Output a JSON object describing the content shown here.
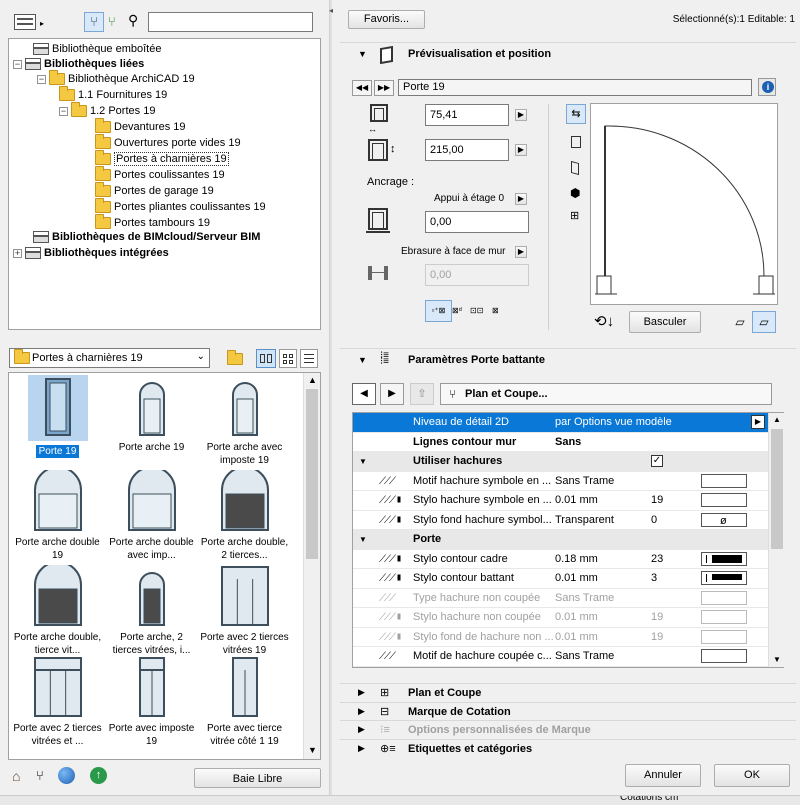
{
  "top_bar": {
    "favoris": "Favoris...",
    "selection_info": "Sélectionné(s):1 Editable: 1"
  },
  "tree": {
    "items": [
      {
        "label": "Bibliothèque emboîtée",
        "bold": false
      },
      {
        "label": "Bibliothèques liées",
        "bold": true
      },
      {
        "label": "Bibliothèque ArchiCAD 19",
        "bold": false
      },
      {
        "label": "1.1 Fournitures 19",
        "bold": false
      },
      {
        "label": "1.2 Portes 19",
        "bold": false
      },
      {
        "label": "Devantures 19",
        "bold": false
      },
      {
        "label": "Ouvertures porte vides 19",
        "bold": false
      },
      {
        "label": "Portes à charnières 19",
        "bold": false
      },
      {
        "label": "Portes coulissantes 19",
        "bold": false
      },
      {
        "label": "Portes de garage 19",
        "bold": false
      },
      {
        "label": "Portes pliantes coulissantes 19",
        "bold": false
      },
      {
        "label": "Portes tambours 19",
        "bold": false
      },
      {
        "label": "Bibliothèques de BIMcloud/Serveur BIM",
        "bold": true
      },
      {
        "label": "Bibliothèques intégrées",
        "bold": true
      }
    ]
  },
  "folder_dropdown": {
    "value": "Portes à charnières 19"
  },
  "thumbs": [
    {
      "label": "Porte 19"
    },
    {
      "label": "Porte arche 19"
    },
    {
      "label": "Porte arche avec imposte 19"
    },
    {
      "label": "Porte arche double 19"
    },
    {
      "label": "Porte arche double avec imp..."
    },
    {
      "label": "Porte arche double, 2 tierces..."
    },
    {
      "label": "Porte arche double, tierce vit..."
    },
    {
      "label": "Porte arche, 2 tierces vitrées, i..."
    },
    {
      "label": "Porte avec 2 tierces vitrées 19"
    },
    {
      "label": "Porte avec 2 tierces vitrées et ..."
    },
    {
      "label": "Porte avec imposte 19"
    },
    {
      "label": "Porte avec tierce vitrée côté 1 19"
    }
  ],
  "bottom_left": {
    "baie_libre": "Baie Libre"
  },
  "preview": {
    "header": "Prévisualisation et position",
    "object_name": "Porte 19",
    "width": "75,41",
    "height": "215,00",
    "ancrage_label": "Ancrage :",
    "anchor_option": "Appui à étage 0",
    "anchor_value": "0,00",
    "ebrasure_label": "Ebrasure à face de mur",
    "ebrasure_value": "0,00",
    "basculer": "Basculer"
  },
  "params": {
    "header": "Paramètres Porte battante",
    "sub_title": "Plan et Coupe...",
    "rows": [
      {
        "name": "Niveau de détail 2D",
        "value": "par Options vue modèle",
        "num": "",
        "state": "selected"
      },
      {
        "name": "Lignes contour mur",
        "value": "Sans",
        "num": "",
        "state": "bold"
      },
      {
        "name": "Utiliser hachures",
        "value": "",
        "num": "",
        "state": "section"
      },
      {
        "name": "Motif hachure symbole en ...",
        "value": "Sans Trame",
        "num": "",
        "state": "normal"
      },
      {
        "name": "Stylo hachure symbole en ...",
        "value": "0.01 mm",
        "num": "19",
        "state": "normal"
      },
      {
        "name": "Stylo fond hachure symbol...",
        "value": "Transparent",
        "num": "0",
        "state": "normal"
      },
      {
        "name": "Porte",
        "value": "",
        "num": "",
        "state": "section"
      },
      {
        "name": "Stylo contour cadre",
        "value": "0.18 mm",
        "num": "23",
        "state": "normal"
      },
      {
        "name": "Stylo contour battant",
        "value": "0.01 mm",
        "num": "3",
        "state": "normal"
      },
      {
        "name": "Type hachure non coupée",
        "value": "Sans Trame",
        "num": "",
        "state": "dim"
      },
      {
        "name": "Stylo hachure non coupée",
        "value": "0.01 mm",
        "num": "19",
        "state": "dim"
      },
      {
        "name": "Stylo fond de hachure non ...",
        "value": "0.01 mm",
        "num": "19",
        "state": "dim"
      },
      {
        "name": "Motif de hachure coupée c...",
        "value": "Sans Trame",
        "num": "",
        "state": "normal"
      }
    ]
  },
  "sections": [
    {
      "label": "Plan et Coupe",
      "dim": false
    },
    {
      "label": "Marque de Cotation",
      "dim": false
    },
    {
      "label": "Options personnalisées de Marque",
      "dim": true
    },
    {
      "label": "Etiquettes et catégories",
      "dim": false
    }
  ],
  "footer": {
    "annuler": "Annuler",
    "ok": "OK",
    "bottom_text": "Cotations cm"
  },
  "colors": {
    "accent": "#0a78d7",
    "selected_bg": "#cce4f7",
    "door_frame": "#3d4f5c",
    "door_fill": "#4a4a4a"
  }
}
